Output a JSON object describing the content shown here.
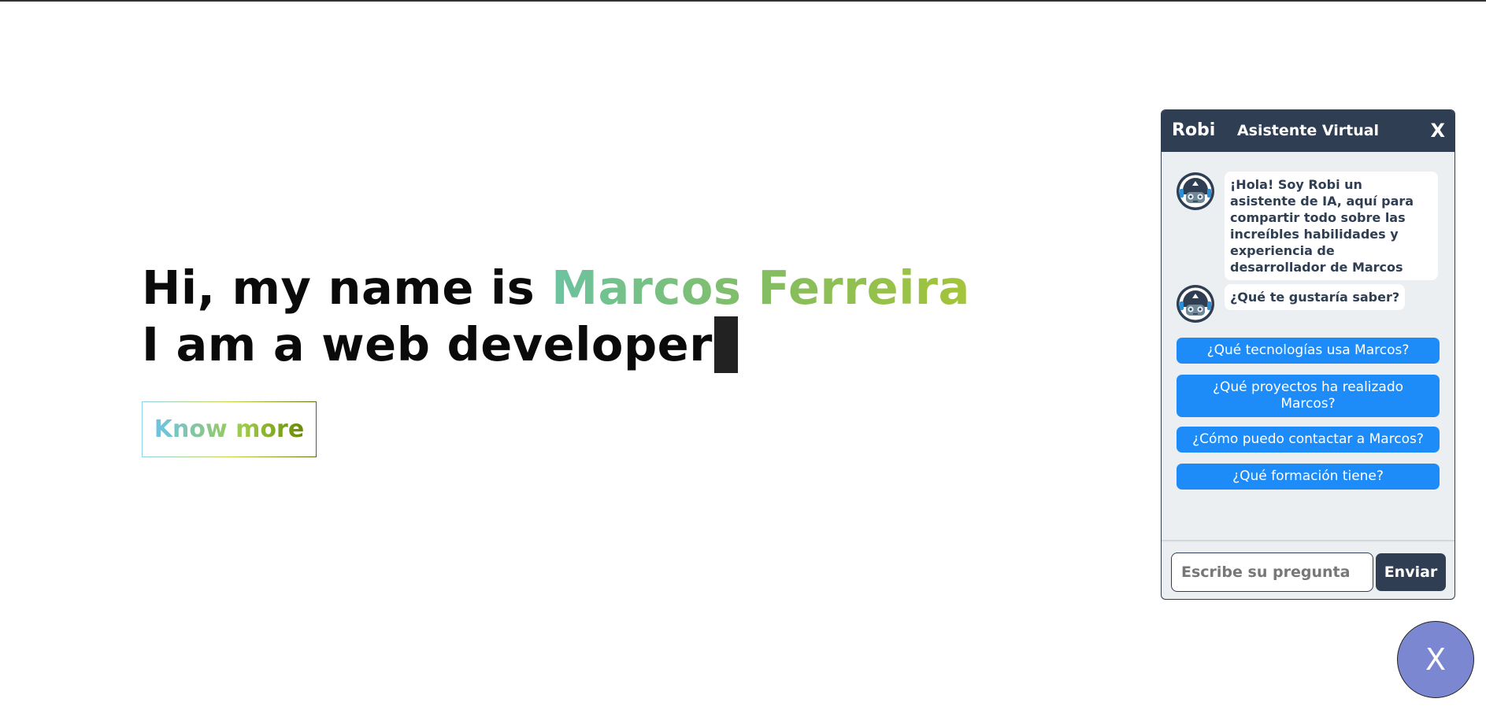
{
  "hero": {
    "greeting_prefix": "Hi, my name is ",
    "name": "Marcos Ferreira",
    "typed_line": "I am a web developer",
    "know_more_label": "Know more"
  },
  "chat": {
    "brand": "Robi",
    "title": "Asistente Virtual",
    "close_label": "X",
    "messages": [
      {
        "text": "¡Hola! Soy Robi un asistente de IA, aquí para compartir todo sobre las increíbles habilidades y experiencia de desarrollador de Marcos"
      },
      {
        "text": "¿Qué te gustaría saber?"
      }
    ],
    "options": [
      {
        "label": "¿Qué tecnologías usa Marcos?"
      },
      {
        "label": "¿Qué proyectos ha realizado Marcos?"
      },
      {
        "label": "¿Cómo puedo contactar a Marcos?"
      },
      {
        "label": "¿Qué formación tiene?"
      }
    ],
    "input": {
      "placeholder": "Escribe su pregunta",
      "value": ""
    },
    "send_label": "Enviar",
    "avatar_icon": "robot-icon"
  },
  "fab": {
    "label": "X"
  },
  "colors": {
    "header": "#2f3e52",
    "option_button": "#1e8cf8",
    "fab": "#7b87d0",
    "name_gradient_start": "#6cc3a0",
    "name_gradient_end": "#a4c43a"
  }
}
